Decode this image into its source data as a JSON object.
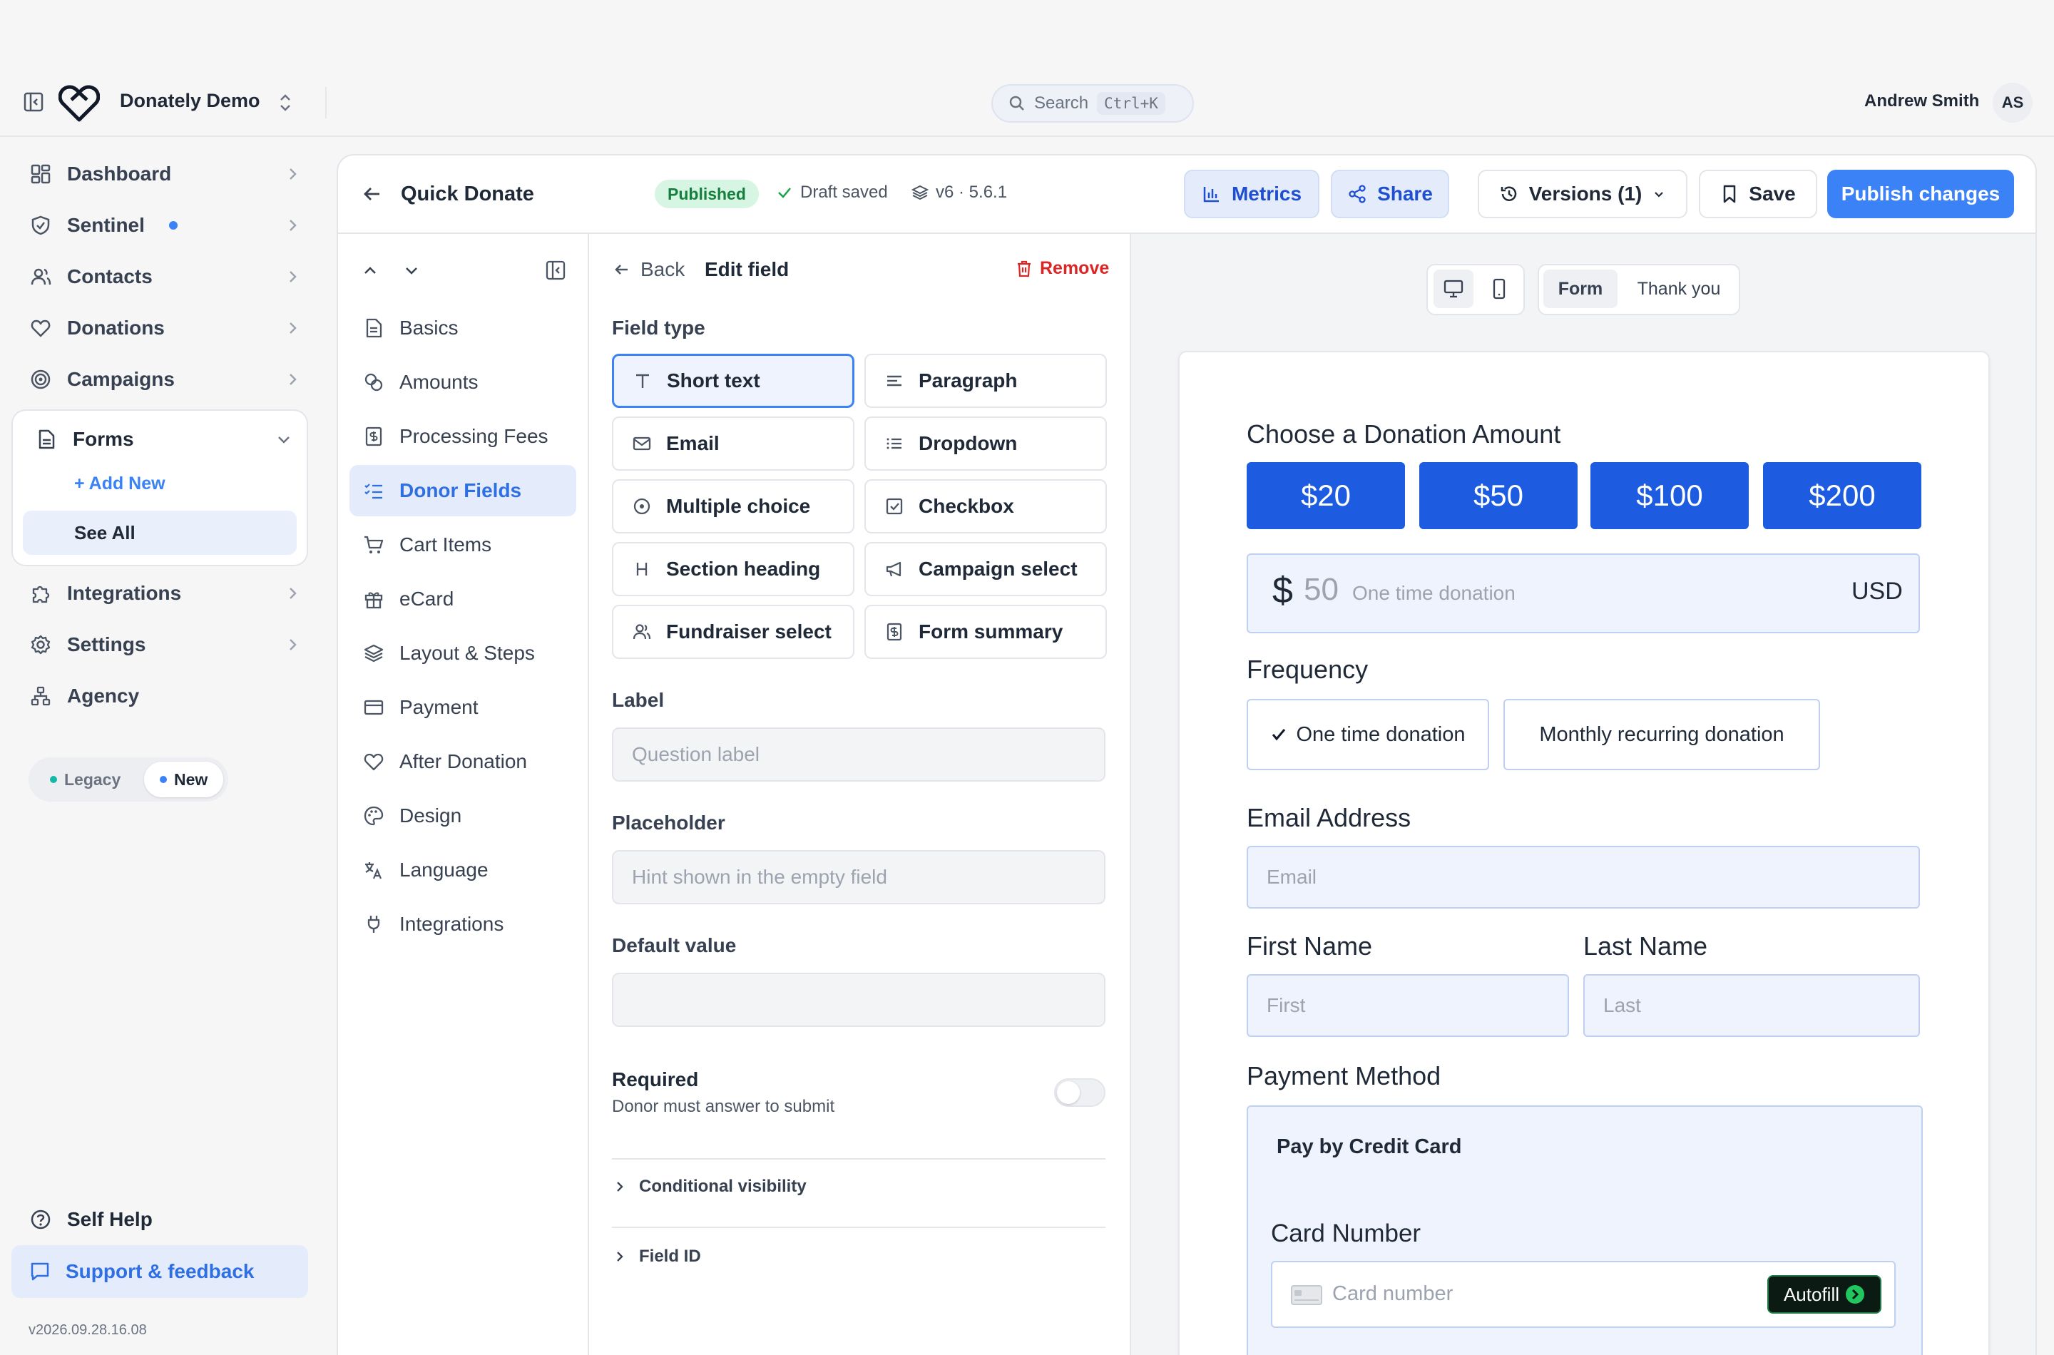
{
  "topbar": {
    "app_name": "Donately Demo",
    "search_label": "Search",
    "search_shortcut": "Ctrl+K",
    "user_name": "Andrew Smith",
    "user_initials": "AS"
  },
  "sidebar": {
    "items": [
      {
        "label": "Dashboard",
        "icon": "dashboard-icon"
      },
      {
        "label": "Sentinel",
        "icon": "shield-icon"
      },
      {
        "label": "Contacts",
        "icon": "contacts-icon"
      },
      {
        "label": "Donations",
        "icon": "heart-icon"
      },
      {
        "label": "Campaigns",
        "icon": "target-icon"
      },
      {
        "label": "Forms",
        "icon": "document-icon"
      },
      {
        "label": "Integrations",
        "icon": "puzzle-icon"
      },
      {
        "label": "Settings",
        "icon": "gear-icon"
      },
      {
        "label": "Agency",
        "icon": "org-chart-icon"
      }
    ],
    "forms_sub": {
      "add_new": "Add New",
      "see_all": "See All"
    },
    "mode_toggle": {
      "legacy": "Legacy",
      "new": "New"
    },
    "self_help": "Self Help",
    "support": "Support & feedback",
    "build": "v2026.09.28.16.08",
    "accent": "#3b82f6"
  },
  "header": {
    "title": "Quick Donate",
    "status": "Published",
    "draft": "Draft saved",
    "version": "v6 · 5.6.1",
    "metrics": "Metrics",
    "share": "Share",
    "versions": "Versions (1)",
    "save": "Save",
    "publish": "Publish changes",
    "publish_color": "#3b82f6"
  },
  "sections": {
    "items": [
      {
        "label": "Basics",
        "icon": "file-text-icon"
      },
      {
        "label": "Amounts",
        "icon": "coins-icon"
      },
      {
        "label": "Processing Fees",
        "icon": "receipt-icon"
      },
      {
        "label": "Donor Fields",
        "icon": "list-checks-icon"
      },
      {
        "label": "Cart Items",
        "icon": "cart-icon"
      },
      {
        "label": "eCard",
        "icon": "gift-icon"
      },
      {
        "label": "Layout & Steps",
        "icon": "layers-icon"
      },
      {
        "label": "Payment",
        "icon": "credit-card-icon"
      },
      {
        "label": "After Donation",
        "icon": "heart-icon"
      },
      {
        "label": "Design",
        "icon": "palette-icon"
      },
      {
        "label": "Language",
        "icon": "translate-icon"
      },
      {
        "label": "Integrations",
        "icon": "plug-icon"
      }
    ],
    "active": "Donor Fields"
  },
  "edit_field": {
    "back": "Back",
    "title": "Edit field",
    "remove": "Remove",
    "field_type_label": "Field type",
    "types": [
      {
        "label": "Short text",
        "icon": "text-icon",
        "selected": true
      },
      {
        "label": "Paragraph",
        "icon": "align-left-icon"
      },
      {
        "label": "Email",
        "icon": "mail-icon"
      },
      {
        "label": "Dropdown",
        "icon": "list-icon"
      },
      {
        "label": "Multiple choice",
        "icon": "radio-icon"
      },
      {
        "label": "Checkbox",
        "icon": "checkbox-icon"
      },
      {
        "label": "Section heading",
        "icon": "heading-icon"
      },
      {
        "label": "Campaign select",
        "icon": "megaphone-icon"
      },
      {
        "label": "Fundraiser select",
        "icon": "users-icon"
      },
      {
        "label": "Form summary",
        "icon": "receipt-icon"
      }
    ],
    "label_label": "Label",
    "label_placeholder": "Question label",
    "placeholder_label": "Placeholder",
    "placeholder_placeholder": "Hint shown in the empty field",
    "default_label": "Default value",
    "default_value": "",
    "required_title": "Required",
    "required_sub": "Donor must answer to submit",
    "required_on": false,
    "conditional": "Conditional visibility",
    "field_id": "Field ID"
  },
  "preview": {
    "view_form": "Form",
    "view_thanks": "Thank you",
    "amount_heading": "Choose a Donation Amount",
    "amounts": [
      "$20",
      "$50",
      "$100",
      "$200"
    ],
    "currency_symbol": "$",
    "amount_value": "50",
    "amount_hint": "One time donation",
    "currency": "USD",
    "frequency_heading": "Frequency",
    "frequency": [
      {
        "label": "One time donation",
        "checked": true
      },
      {
        "label": "Monthly recurring donation",
        "checked": false
      }
    ],
    "email_heading": "Email Address",
    "email_placeholder": "Email",
    "first_heading": "First Name",
    "first_placeholder": "First",
    "last_heading": "Last Name",
    "last_placeholder": "Last",
    "payment_heading": "Payment Method",
    "pay_title": "Pay by Credit Card",
    "card_label": "Card Number",
    "card_placeholder": "Card number",
    "autofill": "Autofill",
    "brand_color": "#1d5be0"
  }
}
